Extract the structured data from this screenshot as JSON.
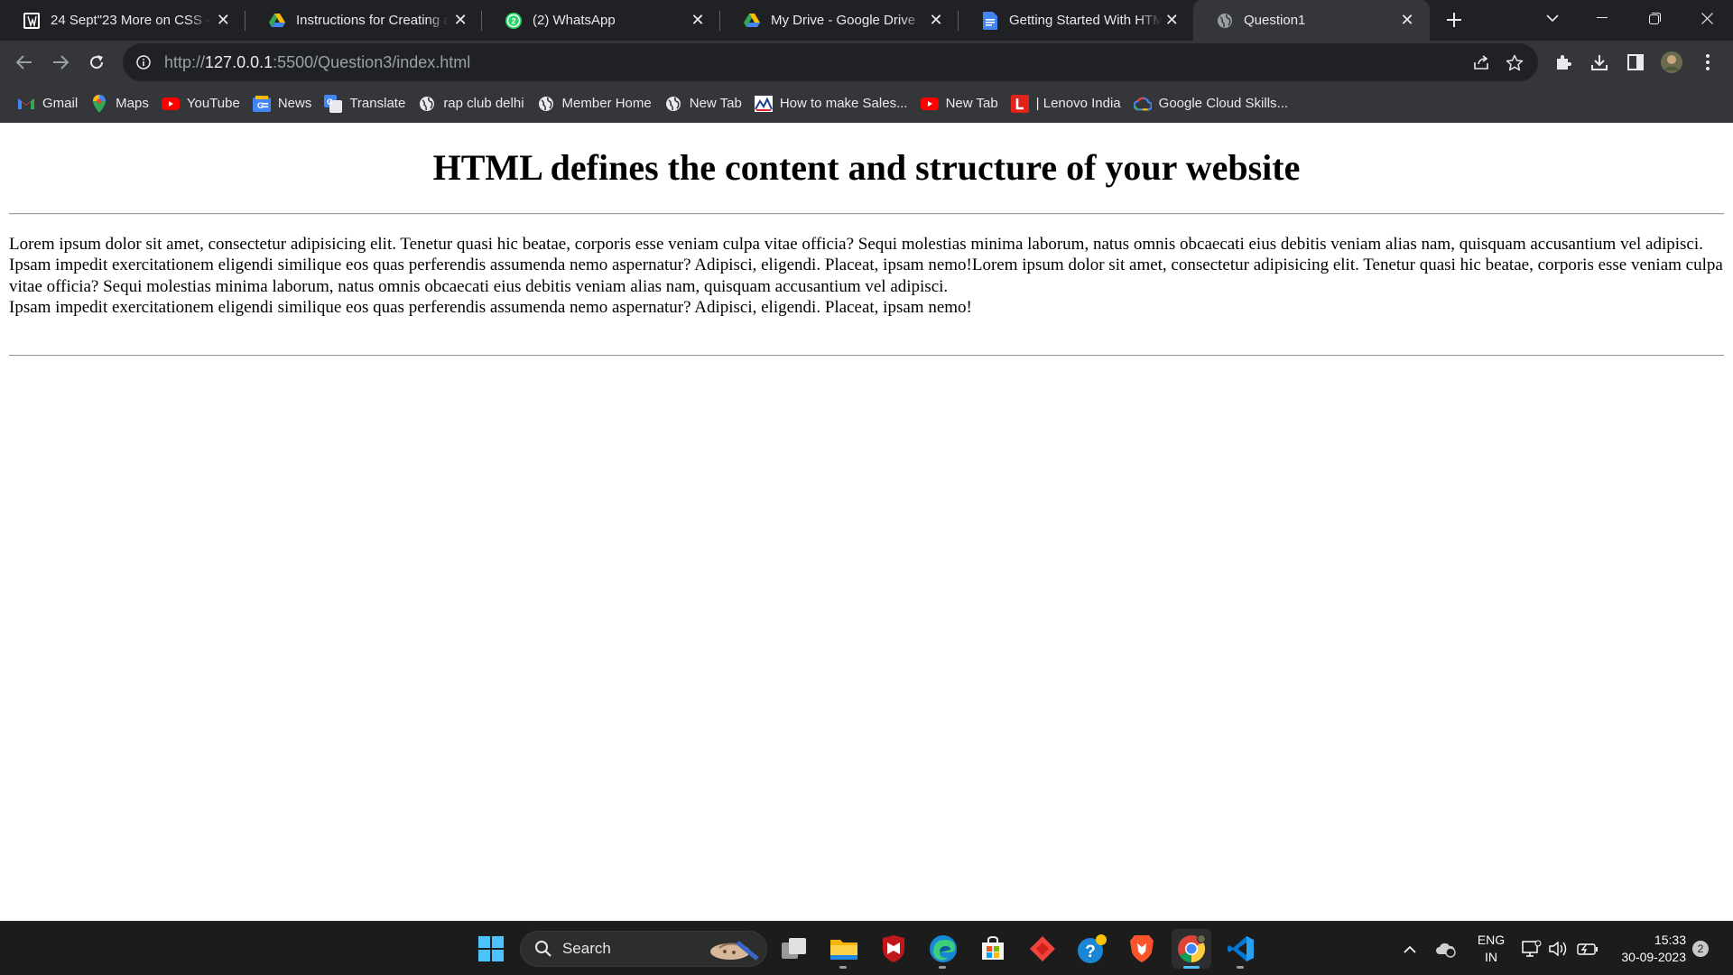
{
  "browser": {
    "tabs": [
      {
        "title": "24 Sept\"23 More on CSS -",
        "icon": "page-icon"
      },
      {
        "title": "Instructions for Creating an",
        "icon": "google-drive-icon"
      },
      {
        "title": "(2) WhatsApp",
        "icon": "whatsapp-icon"
      },
      {
        "title": "My Drive - Google Drive",
        "icon": "google-drive-icon"
      },
      {
        "title": "Getting Started With HTML",
        "icon": "google-docs-icon"
      },
      {
        "title": "Question1",
        "icon": "globe-icon",
        "active": true
      }
    ],
    "url": {
      "scheme": "http://",
      "host": "127.0.0.1",
      "rest": ":5500/Question3/index.html"
    },
    "bookmarks": [
      {
        "label": "Gmail",
        "icon": "gmail-icon"
      },
      {
        "label": "Maps",
        "icon": "maps-icon"
      },
      {
        "label": "YouTube",
        "icon": "youtube-icon"
      },
      {
        "label": "News",
        "icon": "google-news-icon"
      },
      {
        "label": "Translate",
        "icon": "google-translate-icon"
      },
      {
        "label": "rap club delhi",
        "icon": "globe-icon"
      },
      {
        "label": "Member Home",
        "icon": "globe-icon"
      },
      {
        "label": "New Tab",
        "icon": "globe-icon"
      },
      {
        "label": "How to make Sales...",
        "icon": "site-icon"
      },
      {
        "label": "New Tab",
        "icon": "youtube-icon"
      },
      {
        "label": "| Lenovo India",
        "icon": "lenovo-icon"
      },
      {
        "label": "Google Cloud Skills...",
        "icon": "google-cloud-icon"
      }
    ]
  },
  "page": {
    "heading": "HTML defines the content and structure of your website",
    "lines": [
      "Lorem ipsum dolor sit amet, consectetur adipisicing elit. Tenetur quasi hic beatae, corporis esse veniam culpa vitae officia? Sequi molestias minima laborum, natus omnis obcaecati eius debitis veniam alias nam, quisquam accusantium vel adipisci.",
      "Ipsam impedit exercitationem eligendi similique eos quas perferendis assumenda nemo aspernatur? Adipisci, eligendi. Placeat, ipsam nemo!Lorem ipsum dolor sit amet, consectetur adipisicing elit. Tenetur quasi hic beatae, corporis esse veniam culpa vitae officia? Sequi molestias minima laborum, natus omnis obcaecati eius debitis veniam alias nam, quisquam accusantium vel adipisci.",
      "Ipsam impedit exercitationem eligendi similique eos quas perferendis assumenda nemo aspernatur? Adipisci, eligendi. Placeat, ipsam nemo!"
    ]
  },
  "taskbar": {
    "search_label": "Search",
    "language": {
      "line1": "ENG",
      "line2": "IN"
    },
    "time": "15:33",
    "date": "30-09-2023",
    "notification_count": "2"
  },
  "colors": {
    "chrome_dark": "#202124",
    "chrome_toolbar": "#35363a",
    "taskbar": "#1c1c1c",
    "accent": "#4cc2ff"
  }
}
